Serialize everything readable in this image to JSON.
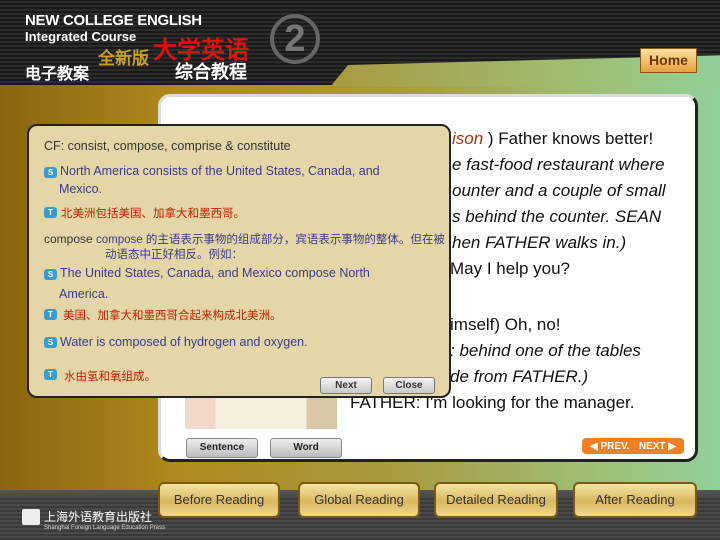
{
  "header": {
    "line1": "NEW COLLEGE ENGLISH",
    "line2": "Integrated Course",
    "line3": "电子教案",
    "new_edition": "全新版",
    "title_zh": "大学英语",
    "subtitle_zh": "综合教程",
    "volume": "2",
    "home": "Home"
  },
  "story": {
    "lines": [
      {
        "pre": "ison",
        "post": " ) Father knows better!"
      },
      {
        "text": "e fast-food restaurant where"
      },
      {
        "text": "ounter and a couple of small"
      },
      {
        "text": "s behind the counter. SEAN"
      },
      {
        "text": "hen FATHER walks in.)"
      },
      {
        "text": "May I help you?"
      },
      {
        "text": "imself) Oh, no!"
      },
      {
        "text": ": behind one of the tables"
      },
      {
        "text": "de from FATHER.)"
      },
      {
        "text": "FATHER: I'm looking for the manager."
      }
    ]
  },
  "panel": {
    "sentence": "Sentence",
    "word": "Word",
    "prev": "PREV.",
    "next": "NEXT"
  },
  "popup": {
    "title": "CF: consist, compose, comprise & constitute",
    "ex1_en_a": "North America consists of the United States, Canada,   and",
    "ex1_en_b": "Mexico.",
    "ex1_zh": "北美洲包括美国、加拿大和墨西哥。",
    "note_a": "compose 的主语表示事物的组成部分，宾语表示事物的整体。但在被",
    "note_b": "动语态中正好相反。例如：",
    "ex2_en_a": "The United States, Canada, and Mexico compose North",
    "ex2_en_b": "America.",
    "ex2_zh": "美国、加拿大和墨西哥合起来构成北美洲。",
    "ex3_en": "Water is composed of hydrogen and oxygen.",
    "ex3_zh": "水由氢和氧组成。",
    "icon_s": "S",
    "icon_t": "T",
    "next": "Next",
    "close": "Close"
  },
  "nav": [
    "Before Reading",
    "Global Reading",
    "Detailed Reading",
    "After Reading"
  ],
  "footer": {
    "press_zh": "上海外语教育出版社",
    "press_en": "Shanghai Foreign Language Education Press"
  }
}
